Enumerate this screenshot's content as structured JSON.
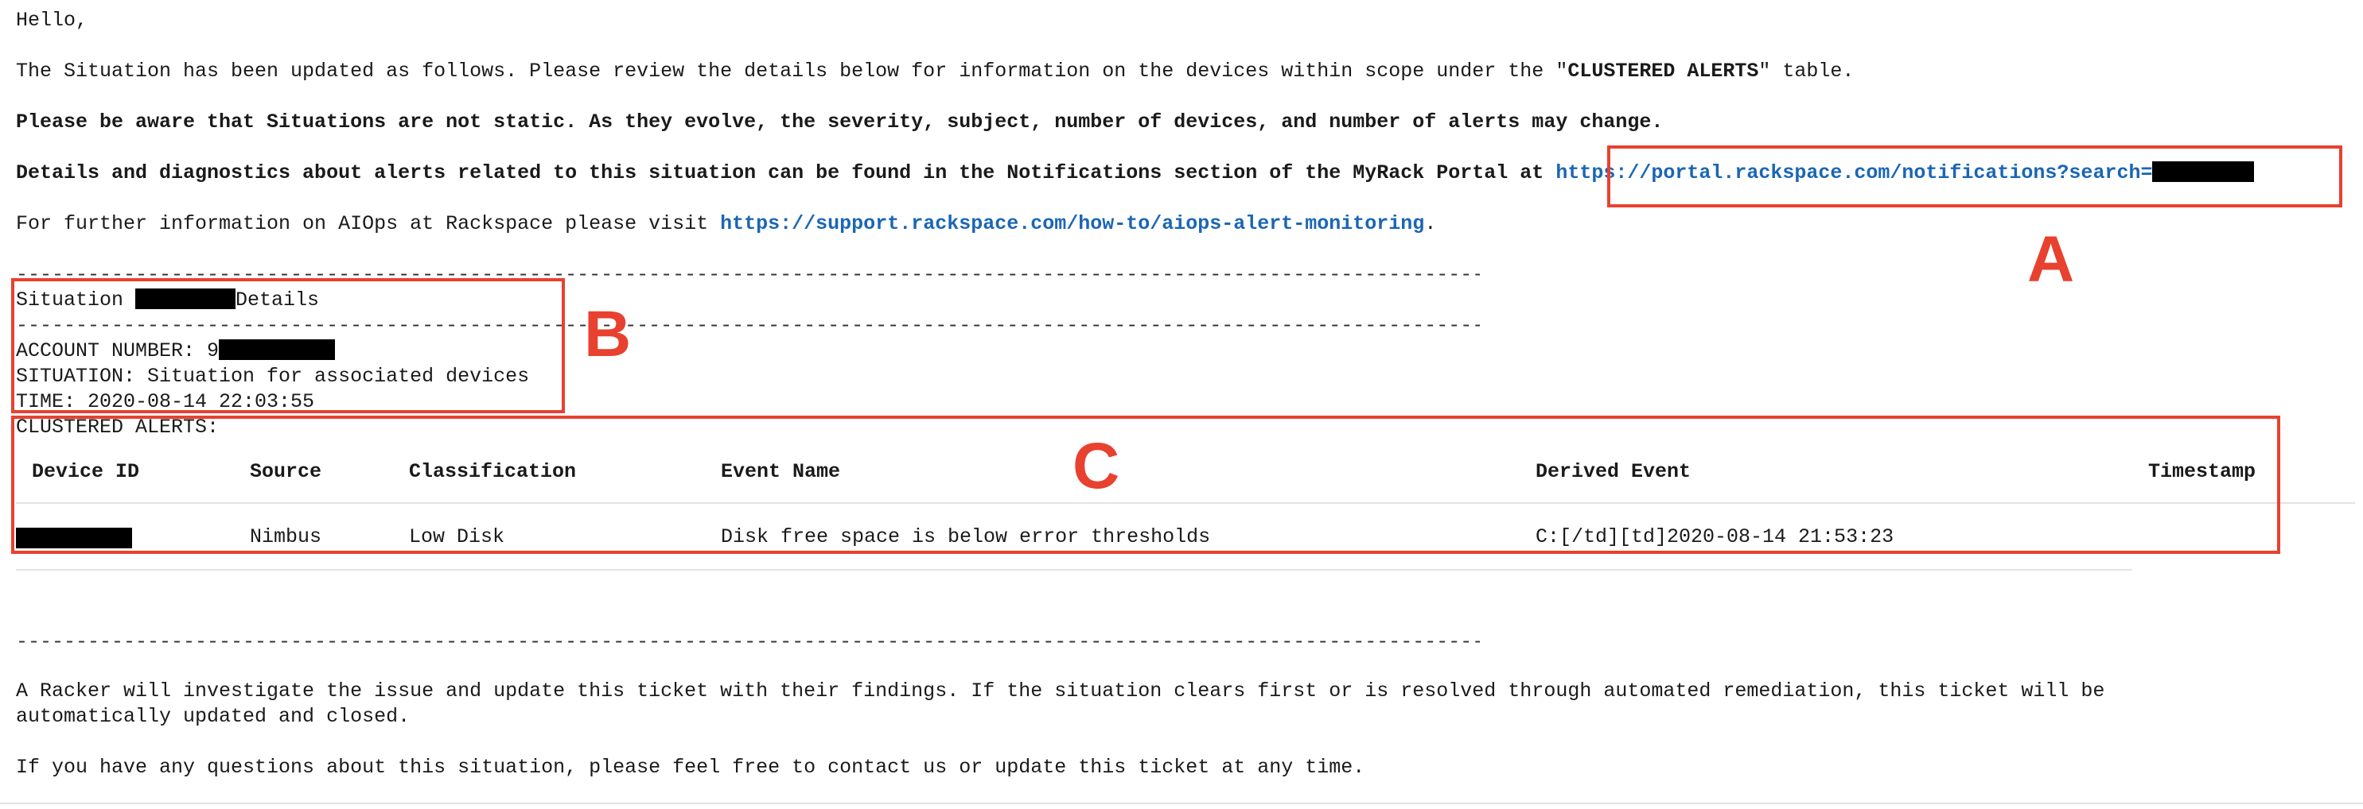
{
  "email": {
    "greeting": "Hello,",
    "intro_before": "The Situation has been updated as follows. Please review the details below for information on the devices within scope under the \"",
    "intro_bold": "CLUSTERED ALERTS",
    "intro_after": "\" table.",
    "warning": "Please be aware that Situations are not static. As they evolve, the severity, subject, number of devices, and number of alerts may change.",
    "details_text": "Details and diagnostics about alerts related to this situation can be found in the Notifications section of the MyRack Portal at ",
    "portal_link": "https://portal.rackspace.com/notifications?search=",
    "further_text": "For further information on AIOps at Rackspace please visit ",
    "support_link": "https://support.rackspace.com/how-to/aiops-alert-monitoring",
    "further_end": ".",
    "divider": "------------------------------------------------------------------------------------------------------------------------------------------------------------------------------------------",
    "situation_prefix": "Situation ",
    "situation_suffix": "Details",
    "account_label": "ACCOUNT NUMBER: 9",
    "situation_line": "SITUATION: Situation for associated devices",
    "time_line": "TIME: 2020-08-14 22:03:55",
    "clustered_label": "CLUSTERED ALERTS:",
    "racker_line1": "A Racker will investigate the issue and update this ticket with their findings. If the situation clears first or is resolved through automated remediation, this ticket will be",
    "racker_line2": "automatically updated and closed.",
    "questions": "If you have any questions about this situation, please feel free to contact us or update this ticket at any time."
  },
  "table": {
    "headers": [
      "Device ID",
      "Source",
      "Classification",
      "Event Name",
      "Derived Event",
      "Timestamp"
    ],
    "row": {
      "source": "Nimbus",
      "classification": "Low Disk",
      "event_name": "Disk free space is below error thresholds",
      "derived_event": "C:[/td][td]2020-08-14 21:53:23"
    }
  },
  "annotations": {
    "a": "A",
    "b": "B",
    "c": "C"
  },
  "colors": {
    "accent_red": "#e8412f",
    "link_blue": "#1a66b5"
  }
}
